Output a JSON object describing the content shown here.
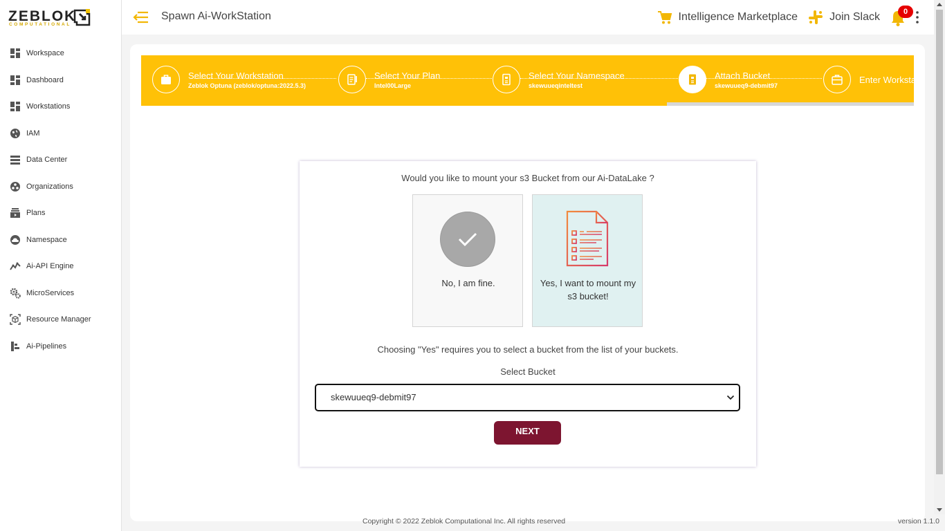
{
  "brand": {
    "name": "ZEBLOK",
    "tagline": "COMPUTATIONAL"
  },
  "sidebar": {
    "items": [
      {
        "label": "Workspace",
        "icon": "grid-icon"
      },
      {
        "label": "Dashboard",
        "icon": "grid-icon"
      },
      {
        "label": "Workstations",
        "icon": "grid-icon"
      },
      {
        "label": "IAM",
        "icon": "globe-icon"
      },
      {
        "label": "Data Center",
        "icon": "server-icon"
      },
      {
        "label": "Organizations",
        "icon": "organization-icon"
      },
      {
        "label": "Plans",
        "icon": "plans-icon"
      },
      {
        "label": "Namespace",
        "icon": "cloud-icon"
      },
      {
        "label": "Ai-API Engine",
        "icon": "chart-line-icon"
      },
      {
        "label": "MicroServices",
        "icon": "gears-icon"
      },
      {
        "label": "Resource Manager",
        "icon": "cube-icon"
      },
      {
        "label": "Ai-Pipelines",
        "icon": "pipeline-icon"
      }
    ]
  },
  "header": {
    "title": "Spawn Ai-WorkStation",
    "marketplace_label": "Intelligence Marketplace",
    "slack_label": "Join Slack",
    "notification_count": "0"
  },
  "stepper": {
    "steps": [
      {
        "title": "Select Your Workstation",
        "subtitle": "Zeblok Optuna (zeblok/optuna:2022.5.3)",
        "icon": "briefcase-icon",
        "active": false
      },
      {
        "title": "Select Your Plan",
        "subtitle": "Intel00Large",
        "icon": "plan-doc-icon",
        "active": false
      },
      {
        "title": "Select Your Namespace",
        "subtitle": "skewuueqinteltest",
        "icon": "namespace-icon",
        "active": false
      },
      {
        "title": "Attach Bucket",
        "subtitle": "skewuueq9-debmit97",
        "icon": "bucket-icon",
        "active": true
      },
      {
        "title": "Enter Workstation",
        "subtitle": "",
        "icon": "workstation-bag-icon",
        "active": false
      }
    ],
    "progress": 0.68
  },
  "bucket": {
    "question": "Would you like to mount your s3 Bucket from our Ai-DataLake ?",
    "option_no": "No, I am fine.",
    "option_yes": "Yes, I want to mount my s3 bucket!",
    "note": "Choosing \"Yes\" requires you to select a bucket from the list of your buckets.",
    "select_label": "Select Bucket",
    "selected_bucket": "skewuueq9-debmit97",
    "next_label": "NEXT"
  },
  "footer": {
    "copyright": "Copyright © 2022 Zeblok Computational Inc. All rights reserved",
    "version": "version 1.1.0"
  },
  "colors": {
    "accent": "#ffc107",
    "primary_button": "#7d1530",
    "badge": "#e60000"
  }
}
